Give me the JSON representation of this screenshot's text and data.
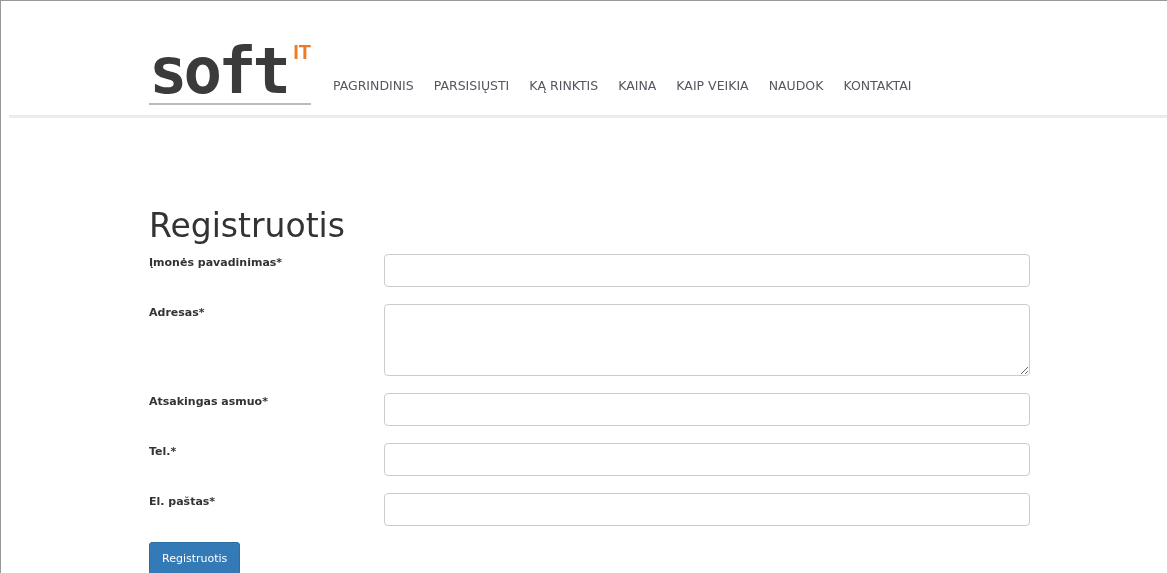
{
  "logo": {
    "text": "soft",
    "badge": "IT"
  },
  "nav": [
    "PAGRINDINIS",
    "PARSISIŲSTI",
    "KĄ RINKTIS",
    "KAINA",
    "KAIP VEIKIA",
    "NAUDOK",
    "KONTAKTAI"
  ],
  "form": {
    "title": "Registruotis",
    "fields": [
      {
        "label": "Įmonės pavadinimas*",
        "kind": "input"
      },
      {
        "label": "Adresas*",
        "kind": "textarea"
      },
      {
        "label": "Atsakingas asmuo*",
        "kind": "input"
      },
      {
        "label": "Tel.*",
        "kind": "input"
      },
      {
        "label": "El. paštas*",
        "kind": "input"
      }
    ],
    "submit": "Registruotis"
  }
}
